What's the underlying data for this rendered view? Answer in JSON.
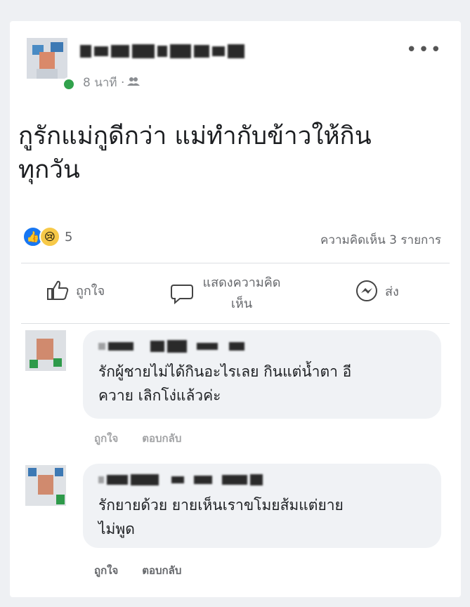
{
  "post": {
    "time": "8 นาที ·",
    "text_line1": "กูรักแม่กูดีกว่า แม่ทำกับข้าวให้กิน",
    "text_line2": "ทุกวัน",
    "reaction_count": "5",
    "comment_count": "ความคิดเห็น 3 รายการ"
  },
  "actions": {
    "like": "ถูกใจ",
    "comment_line1": "แสดงความคิด",
    "comment_line2": "เห็น",
    "share": "ส่ง"
  },
  "comments": [
    {
      "text_line1": "รักผู้ชายไม่ได้กินอะไรเลย กินแต่น้ำตา อี",
      "text_line2": "ควาย เลิกโง่แล้วค่ะ",
      "like": "ถูกใจ",
      "reply": "ตอบกลับ"
    },
    {
      "text_line1": "รักยายด้วย ยายเห็นเราขโมยส้มแต่ยาย",
      "text_line2": "ไม่พูด",
      "like": "ถูกใจ",
      "reply": "ตอบกลับ"
    }
  ],
  "colors": {
    "like_blue": "#1877f2",
    "online_green": "#31a24c",
    "bubble_gray": "#f0f2f5"
  }
}
